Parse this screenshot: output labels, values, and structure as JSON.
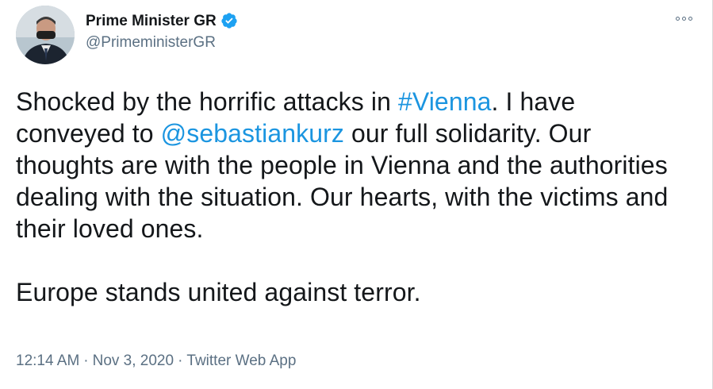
{
  "author": {
    "display_name": "Prime Minister GR",
    "handle": "@PrimeministerGR",
    "verified": true,
    "avatar_icon": "profile-photo"
  },
  "tweet": {
    "line1": {
      "before": "Shocked by the horrific attacks in ",
      "hashtag": "#Vienna",
      "after": ". I have conveyed to ",
      "mention": "@sebastiankurz",
      "rest": " our full solidarity. Our thoughts are with the people in Vienna and the authorities dealing with the situation. Our hearts, with the victims and their loved ones."
    },
    "line2": "Europe stands united against terror."
  },
  "meta": {
    "time": "12:14 AM",
    "separator": "·",
    "date": "Nov 3, 2020",
    "source": "Twitter Web App"
  },
  "menu": {
    "more_icon": "more-horizontal-icon"
  },
  "colors": {
    "link": "#1b95e0",
    "muted": "#5b7083",
    "text": "#14171a",
    "verified": "#1da1f2"
  }
}
